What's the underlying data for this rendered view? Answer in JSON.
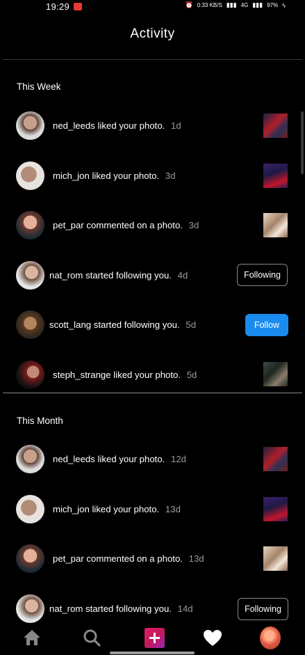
{
  "status_bar": {
    "time": "19:29",
    "speed": "0.33",
    "speed_unit": "KB/S",
    "network": "4G",
    "battery": "97%"
  },
  "header": {
    "title": "Activity"
  },
  "sections": [
    {
      "title": "This Week",
      "items": [
        {
          "user": "ned_leeds",
          "action": "liked your photo.",
          "time": "1d",
          "kind": "photo"
        },
        {
          "user": "mich_jon",
          "action": "liked your photo.",
          "time": "3d",
          "kind": "photo"
        },
        {
          "user": "pet_par",
          "action": "commented on a photo.",
          "time": "3d",
          "kind": "photo"
        },
        {
          "user": "nat_rom",
          "action": "started following you.",
          "time": "4d",
          "kind": "button",
          "button": "Following"
        },
        {
          "user": "scott_lang",
          "action": "started following you.",
          "time": "5d",
          "kind": "button",
          "button": "Follow"
        },
        {
          "user": "steph_strange",
          "action": "liked your photo.",
          "time": "5d",
          "kind": "photo"
        }
      ]
    },
    {
      "title": "This Month",
      "items": [
        {
          "user": "ned_leeds",
          "action": "liked your photo.",
          "time": "12d",
          "kind": "photo"
        },
        {
          "user": "mich_jon",
          "action": "liked your photo.",
          "time": "13d",
          "kind": "photo"
        },
        {
          "user": "pet_par",
          "action": "commented on a photo.",
          "time": "13d",
          "kind": "photo"
        },
        {
          "user": "nat_rom",
          "action": "started following you.",
          "time": "14d",
          "kind": "button",
          "button": "Following"
        }
      ]
    }
  ],
  "bottom_nav": {
    "items": [
      "home-icon",
      "search-icon",
      "add-post-icon",
      "heart-icon",
      "profile-avatar"
    ]
  },
  "colors": {
    "background": "#000000",
    "follow_button": "#1a8cf0",
    "muted_text": "#9a9a9a"
  }
}
